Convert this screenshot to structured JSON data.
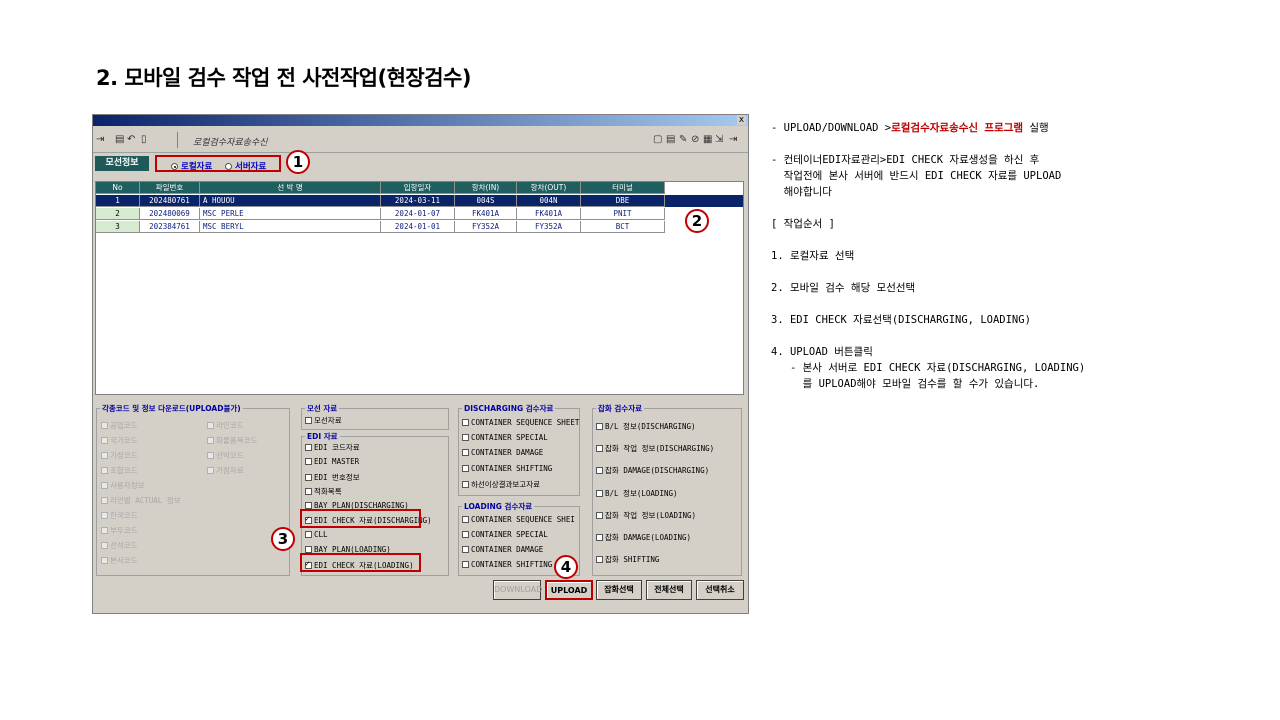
{
  "slide_title": "2. 모바일 검수 작업 전 사전작업(현장검수)",
  "window": {
    "close": "x",
    "toolbar_title": "로컬검수자료송수신",
    "toolbar_left_icons": [
      "⇥",
      "▤",
      "↶",
      "▯"
    ],
    "toolbar_right_icons": [
      "▢",
      "▤",
      "✎",
      "⊘",
      "▦",
      "⇲",
      "⇥"
    ]
  },
  "vessel_section": {
    "label": "모선정보",
    "radio_local": "로컬자료",
    "radio_server": "서버자료"
  },
  "grid": {
    "columns": [
      "No",
      "파일번호",
      "선 박 명",
      "입항일자",
      "항차(IN)",
      "항차(OUT)",
      "터미널"
    ],
    "rows": [
      [
        "1",
        "202480761",
        "A HOUOU",
        "2024-03-11",
        "004S",
        "004N",
        "DBE"
      ],
      [
        "2",
        "202480069",
        "MSC PERLE",
        "2024-01-07",
        "FK401A",
        "FK401A",
        "PNIT"
      ],
      [
        "3",
        "202384761",
        "MSC BERYL",
        "2024-01-01",
        "FY352A",
        "FY352A",
        "BCT"
      ]
    ]
  },
  "panels": {
    "codes": {
      "title": "각종코드 및 정보 다운로드(UPLOAD불가)",
      "col1": [
        "공입코드",
        "국가코드",
        "기성코드",
        "조합코드",
        "사용자정보",
        "라인별 ACTUAL 정보",
        "한국코드",
        "부두코드",
        "선석코드",
        "본사코드"
      ],
      "col2": [
        "라인코드",
        "화물품목코드",
        "선박코드",
        "거점자료"
      ]
    },
    "vessel_data": {
      "title": "모선 자료",
      "items": [
        "모선자료"
      ]
    },
    "edi": {
      "title": "EDI 자료",
      "items": [
        "EDI 코드자료",
        "EDI MASTER",
        "EDI 번호정보",
        "적화목록",
        "BAY PLAN(DISCHARGING)",
        "EDI CHECK 자료(DISCHARGING)",
        "CLL",
        "BAY PLAN(LOADING)",
        "EDI CHECK 자료(LOADING)"
      ]
    },
    "discharging": {
      "title": "DISCHARGING 검수자료",
      "items": [
        "CONTAINER SEQUENCE SHEET",
        "CONTAINER SPECIAL",
        "CONTAINER DAMAGE",
        "CONTAINER SHIFTING",
        "하선이상결과보고자료"
      ]
    },
    "loading": {
      "title": "LOADING 검수자료",
      "items": [
        "CONTAINER SEQUENCE SHEI",
        "CONTAINER SPECIAL",
        "CONTAINER DAMAGE",
        "CONTAINER SHIFTING"
      ]
    },
    "cargo": {
      "title": "잡화 검수자료",
      "items": [
        "B/L 정보(DISCHARGING)",
        "잡화 작업 정보(DISCHARGING)",
        "잡화 DAMAGE(DISCHARGING)",
        "B/L 정보(LOADING)",
        "잡화 작업 정보(LOADING)",
        "잡화 DAMAGE(LOADING)",
        "잡화 SHIFTING"
      ]
    }
  },
  "buttons": {
    "download": "DOWNLOAD",
    "upload": "UPLOAD",
    "cargo_select": "잡화선택",
    "select_all": "전체선택",
    "cancel_select": "선택취소"
  },
  "badges": [
    "1",
    "2",
    "3",
    "4"
  ],
  "notes": {
    "line1_prefix": "- UPLOAD/DOWNLOAD >",
    "line1_red": "로컬검수자료송수신 프로그램",
    "line1_suffix": " 실행",
    "line2": "- 컨테이너EDI자료관리>EDI CHECK 자료생성을 하신 후",
    "line3": "  작업전에 본사 서버에 반드시 EDI CHECK 자료를 UPLOAD",
    "line4": "  해야합니다",
    "steps_title": "[ 작업순서 ]",
    "step1": "1. 로컬자료 선택",
    "step2": "2. 모바일 검수 해당 모선선택",
    "step3": "3. EDI CHECK 자료선택(DISCHARGING, LOADING)",
    "step4": "4. UPLOAD 버튼클릭",
    "step4_sub1": "   - 본사 서버로 EDI CHECK 자료(DISCHARGING, LOADING)",
    "step4_sub2": "     를 UPLOAD해야 모바일 검수를 할 수가 있습니다."
  }
}
